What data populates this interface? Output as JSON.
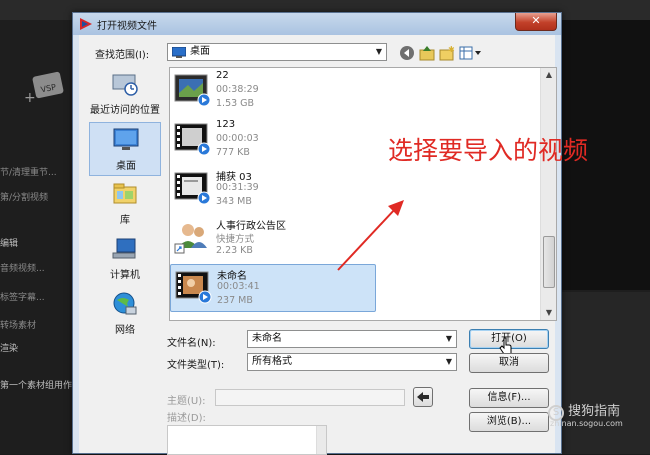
{
  "background_app": {
    "left_menu": [
      "节/清理重节...",
      "第/分割视频",
      "编辑",
      "音频视频...",
      "标签字幕...",
      "转场素材",
      "渲染",
      "第一个素材组用作/"
    ]
  },
  "dialog": {
    "title": "打开视频文件",
    "close_label": "✕",
    "lookin_label": "查找范围(I):",
    "lookin_value": "桌面",
    "places": [
      {
        "label": "最近访问的位置",
        "icon": "recent-places-icon"
      },
      {
        "label": "桌面",
        "icon": "desktop-icon"
      },
      {
        "label": "库",
        "icon": "library-icon"
      },
      {
        "label": "计算机",
        "icon": "computer-icon"
      },
      {
        "label": "网络",
        "icon": "network-icon"
      }
    ],
    "files": [
      {
        "name": "22",
        "line1": "00:38:29",
        "line2": "1.53 GB"
      },
      {
        "name": "123",
        "line1": "00:00:03",
        "line2": "777 KB"
      },
      {
        "name": "捕获 03",
        "line1": "00:31:39",
        "line2": "343 MB"
      },
      {
        "name": "人事行政公告区",
        "line1": "快捷方式",
        "line2": "2.23 KB"
      },
      {
        "name": "未命名",
        "line1": "00:03:41",
        "line2": "237 MB"
      }
    ],
    "filename_label": "文件名(N):",
    "filename_value": "未命名",
    "filetype_label": "文件类型(T):",
    "filetype_value": "所有格式",
    "open_button": "打开(O)",
    "cancel_button": "取消",
    "subject_label": "主题(U):",
    "description_label": "描述(D):",
    "info_button": "信息(F)...",
    "browse_button": "浏览(B)..."
  },
  "annotation": "选择要导入的视频",
  "watermark": {
    "brand": "搜狗指南",
    "url": "zhinan.sogou.com"
  }
}
